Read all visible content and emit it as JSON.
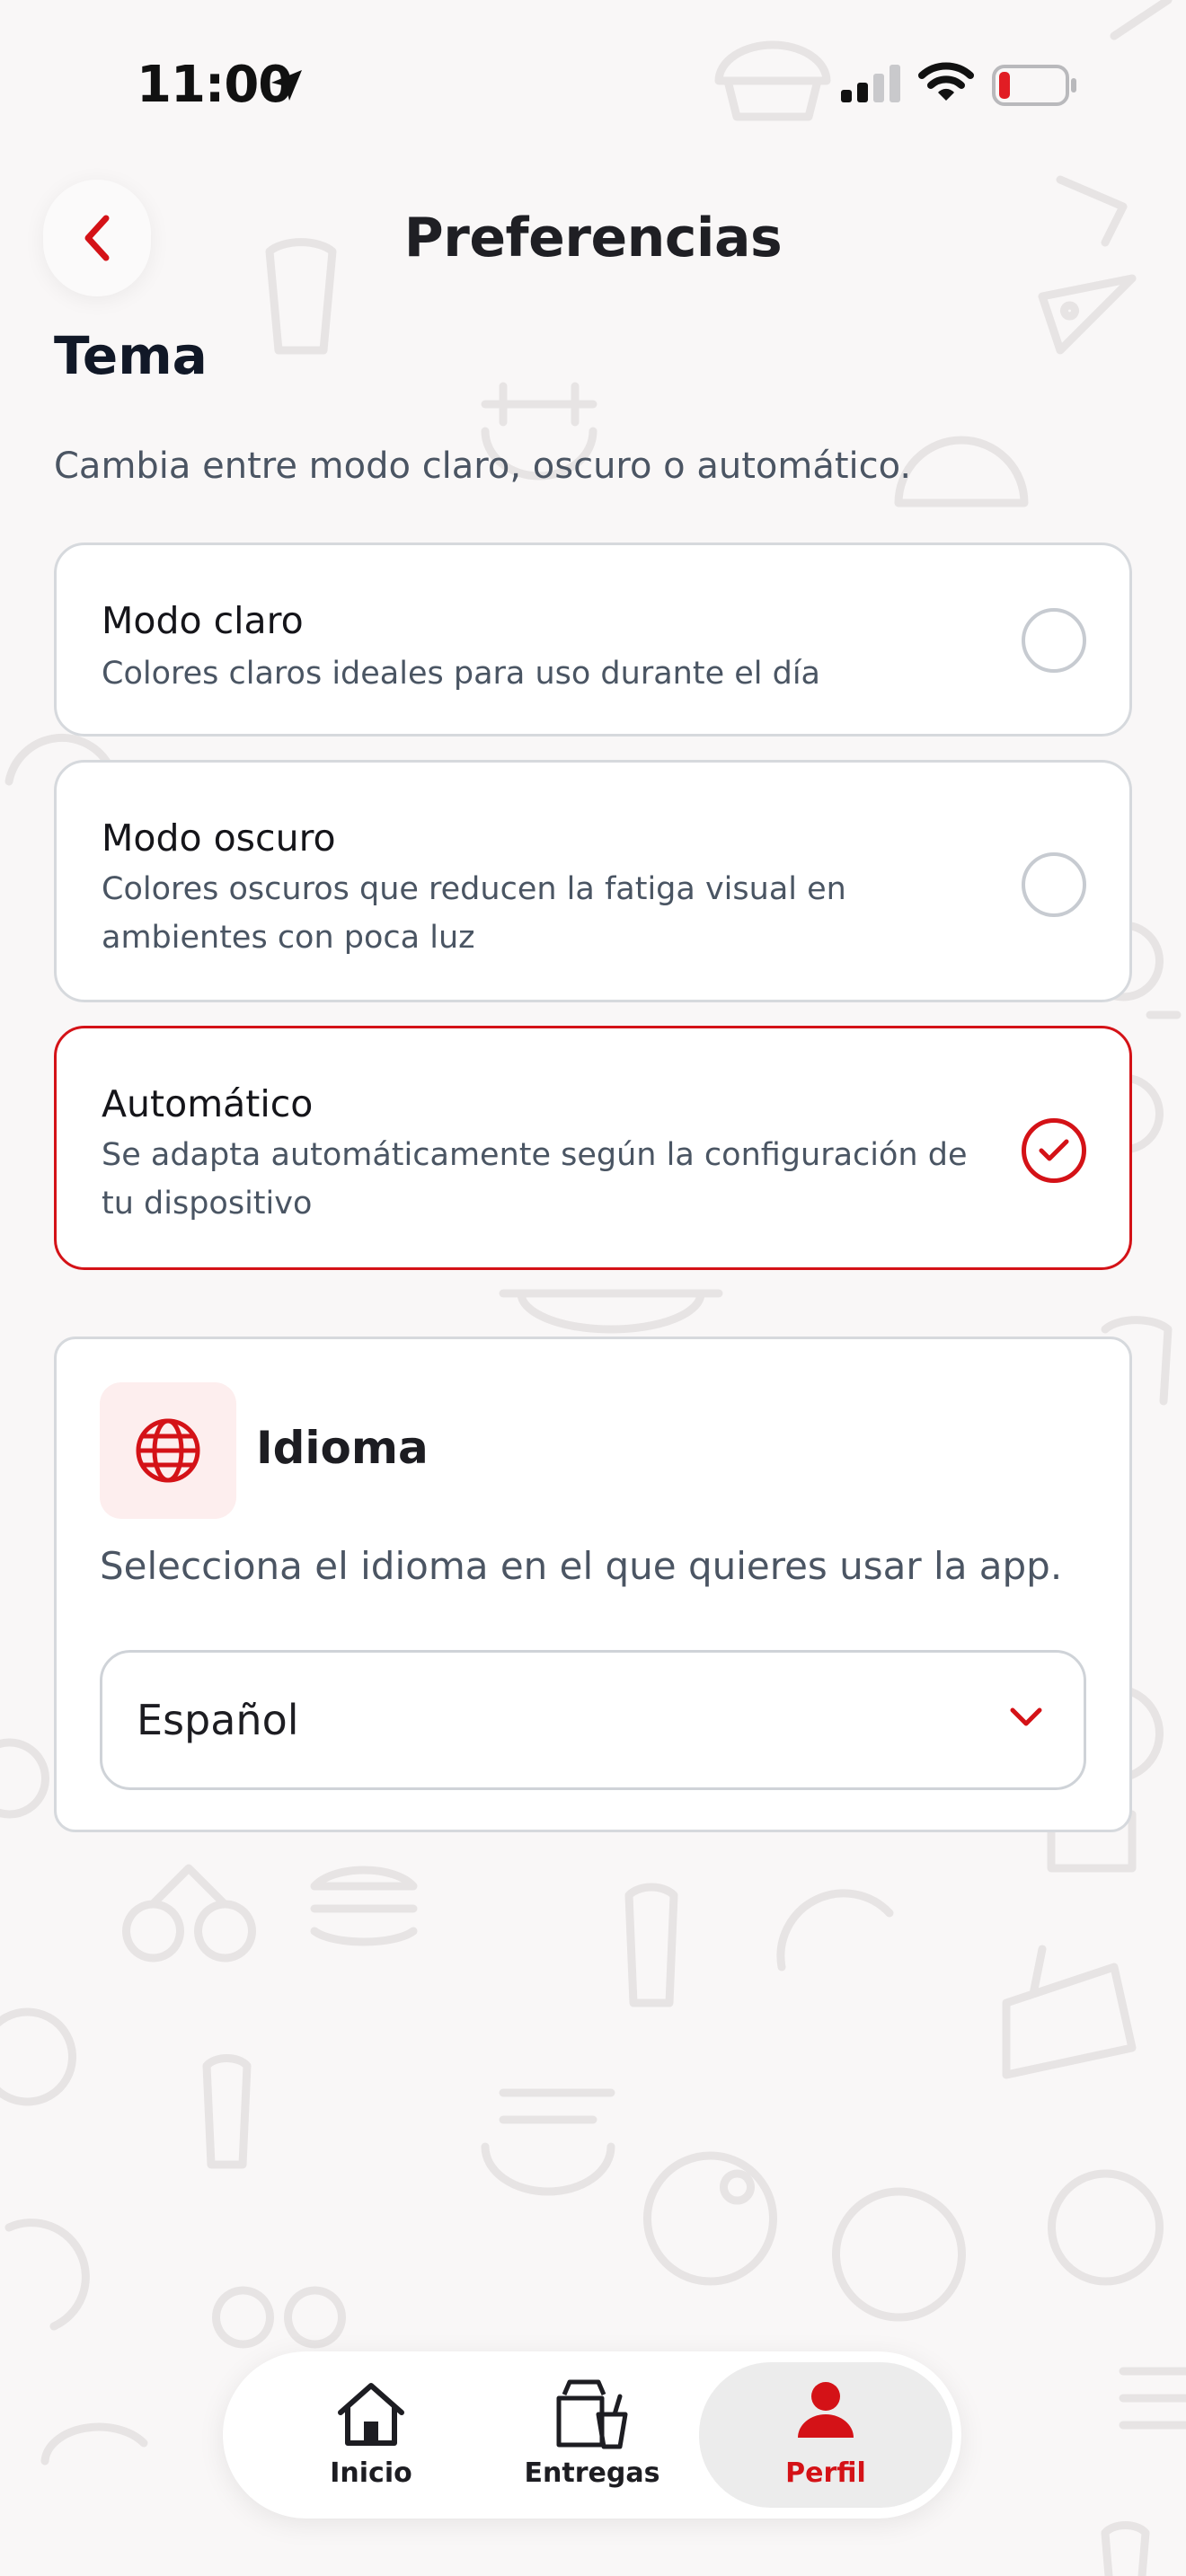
{
  "status_bar": {
    "time": "11:00"
  },
  "header": {
    "title": "Preferencias"
  },
  "theme": {
    "title": "Tema",
    "description": "Cambia entre modo claro, oscuro o automático.",
    "options": [
      {
        "label": "Modo claro",
        "sub": "Colores claros ideales para uso durante el día",
        "selected": false
      },
      {
        "label": "Modo oscuro",
        "sub": "Colores oscuros que reducen la fatiga visual en ambientes con poca luz",
        "selected": false
      },
      {
        "label": "Automático",
        "sub": "Se adapta automáticamente según la configuración de tu dispositivo",
        "selected": true
      }
    ]
  },
  "language": {
    "title": "Idioma",
    "description": "Selecciona el idioma en el que quieres usar la app.",
    "selected": "Español"
  },
  "nav": {
    "items": [
      {
        "label": "Inicio",
        "icon": "home-icon",
        "active": false
      },
      {
        "label": "Entregas",
        "icon": "delivery-bag-icon",
        "active": false
      },
      {
        "label": "Perfil",
        "icon": "person-icon",
        "active": true
      }
    ]
  },
  "colors": {
    "accent": "#d41217",
    "border": "#d6d9dd",
    "background": "#f9f7f7"
  }
}
